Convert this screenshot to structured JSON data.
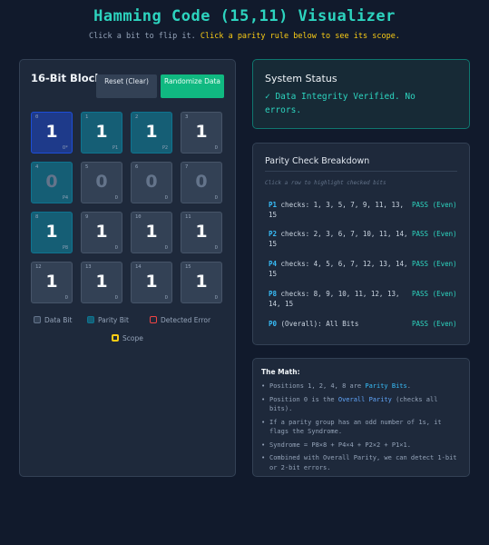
{
  "header": {
    "title": "Hamming Code (15,11) Visualizer",
    "subtitle_plain": "Click a bit to flip it.",
    "subtitle_highlight": "Click a parity rule below to see its scope."
  },
  "block": {
    "title": "16-Bit Block",
    "reset_label": "Reset (Clear)",
    "randomize_label": "Randomize Data",
    "bits": [
      {
        "index": "0",
        "value": "1",
        "tag": "O*",
        "kind": "overall"
      },
      {
        "index": "1",
        "value": "1",
        "tag": "P1",
        "kind": "parity"
      },
      {
        "index": "2",
        "value": "1",
        "tag": "P2",
        "kind": "parity"
      },
      {
        "index": "3",
        "value": "1",
        "tag": "D",
        "kind": "data"
      },
      {
        "index": "4",
        "value": "0",
        "tag": "P4",
        "kind": "parity"
      },
      {
        "index": "5",
        "value": "0",
        "tag": "D",
        "kind": "data"
      },
      {
        "index": "6",
        "value": "0",
        "tag": "D",
        "kind": "data"
      },
      {
        "index": "7",
        "value": "0",
        "tag": "D",
        "kind": "data"
      },
      {
        "index": "8",
        "value": "1",
        "tag": "P8",
        "kind": "parity"
      },
      {
        "index": "9",
        "value": "1",
        "tag": "D",
        "kind": "data"
      },
      {
        "index": "10",
        "value": "1",
        "tag": "D",
        "kind": "data"
      },
      {
        "index": "11",
        "value": "1",
        "tag": "D",
        "kind": "data"
      },
      {
        "index": "12",
        "value": "1",
        "tag": "D",
        "kind": "data"
      },
      {
        "index": "13",
        "value": "1",
        "tag": "D",
        "kind": "data"
      },
      {
        "index": "14",
        "value": "1",
        "tag": "D",
        "kind": "data"
      },
      {
        "index": "15",
        "value": "1",
        "tag": "D",
        "kind": "data"
      }
    ]
  },
  "legend": {
    "data_bit": "Data Bit",
    "parity_bit": "Parity Bit",
    "detected_error": "Detected Error",
    "scope": "Scope"
  },
  "status": {
    "title": "System Status",
    "message": "✓ Data Integrity Verified. No errors."
  },
  "parity": {
    "title": "Parity Check Breakdown",
    "hint": "Click a row to highlight checked bits",
    "rows": [
      {
        "label": "P1",
        "positions": "checks: 1, 3, 5, 7, 9, 11, 13, 15",
        "result": "PASS (Even)"
      },
      {
        "label": "P2",
        "positions": "checks: 2, 3, 6, 7, 10, 11, 14, 15",
        "result": "PASS (Even)"
      },
      {
        "label": "P4",
        "positions": "checks: 4, 5, 6, 7, 12, 13, 14, 15",
        "result": "PASS (Even)"
      },
      {
        "label": "P8",
        "positions": "checks: 8, 9, 10, 11, 12, 13, 14, 15",
        "result": "PASS (Even)"
      },
      {
        "label": "P0",
        "positions": "(Overall): All Bits",
        "result": "PASS (Even)"
      }
    ]
  },
  "math": {
    "title": "The Math:",
    "item1_pre": "Positions 1, 2, 4, 8 are ",
    "item1_hl": "Parity Bits",
    "item1_post": ".",
    "item2_pre": "Position 0 is the ",
    "item2_hl": "Overall Parity",
    "item2_post": " (checks all bits).",
    "item3": "If a parity group has an odd number of 1s, it flags the Syndrome.",
    "item4": "Syndrome = P8×8 + P4×4 + P2×2 + P1×1.",
    "item5": "Combined with Overall Parity, we can detect 1-bit or 2-bit errors."
  },
  "colors": {
    "accent": "#2dd4bf",
    "highlight": "#facc15",
    "data_bit": "#334155",
    "parity_bit": "#155e75",
    "overall_bit": "#1e3a8a",
    "error": "#ef4444",
    "button_green": "#10b981"
  }
}
